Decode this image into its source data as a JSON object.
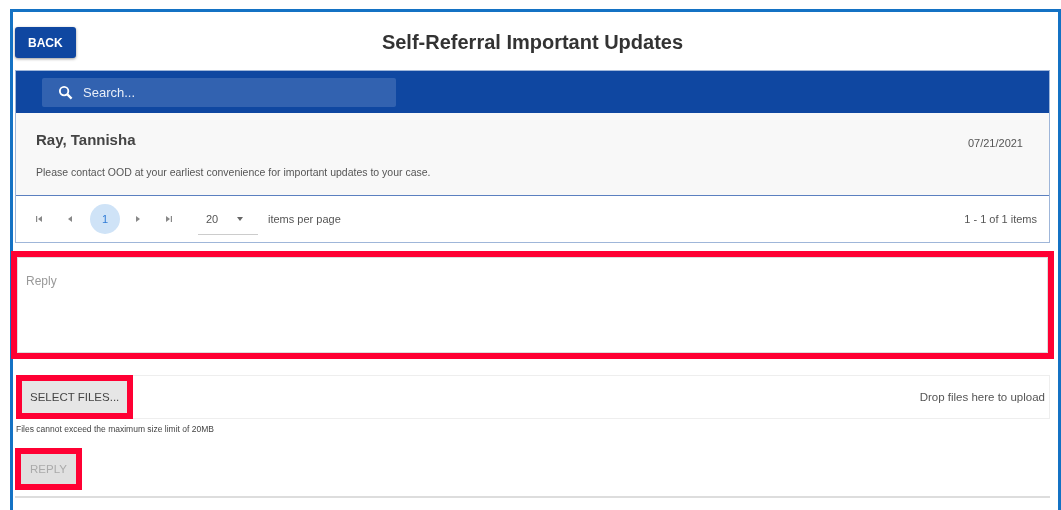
{
  "header": {
    "back_button": "BACK",
    "title": "Self-Referral Important Updates"
  },
  "search": {
    "placeholder": "Search..."
  },
  "messages": [
    {
      "sender": "Ray, Tannisha",
      "date": "07/21/2021",
      "body": "Please contact OOD at your earliest convenience for important updates to your case."
    }
  ],
  "pager": {
    "pages": [
      {
        "label": "1",
        "selected": true
      }
    ],
    "page_size": "20",
    "page_size_label": "items per page",
    "summary": "1 - 1 of 1 items"
  },
  "reply_field": {
    "placeholder": "Reply",
    "highlighted": true
  },
  "upload": {
    "button": "SELECT FILES...",
    "button_highlighted": true,
    "drop_hint": "Drop files here to upload",
    "note": "Files cannot exceed the maximum size limit of 20MB"
  },
  "reply_button": {
    "label": "REPLY",
    "disabled": true,
    "highlighted": true
  }
}
